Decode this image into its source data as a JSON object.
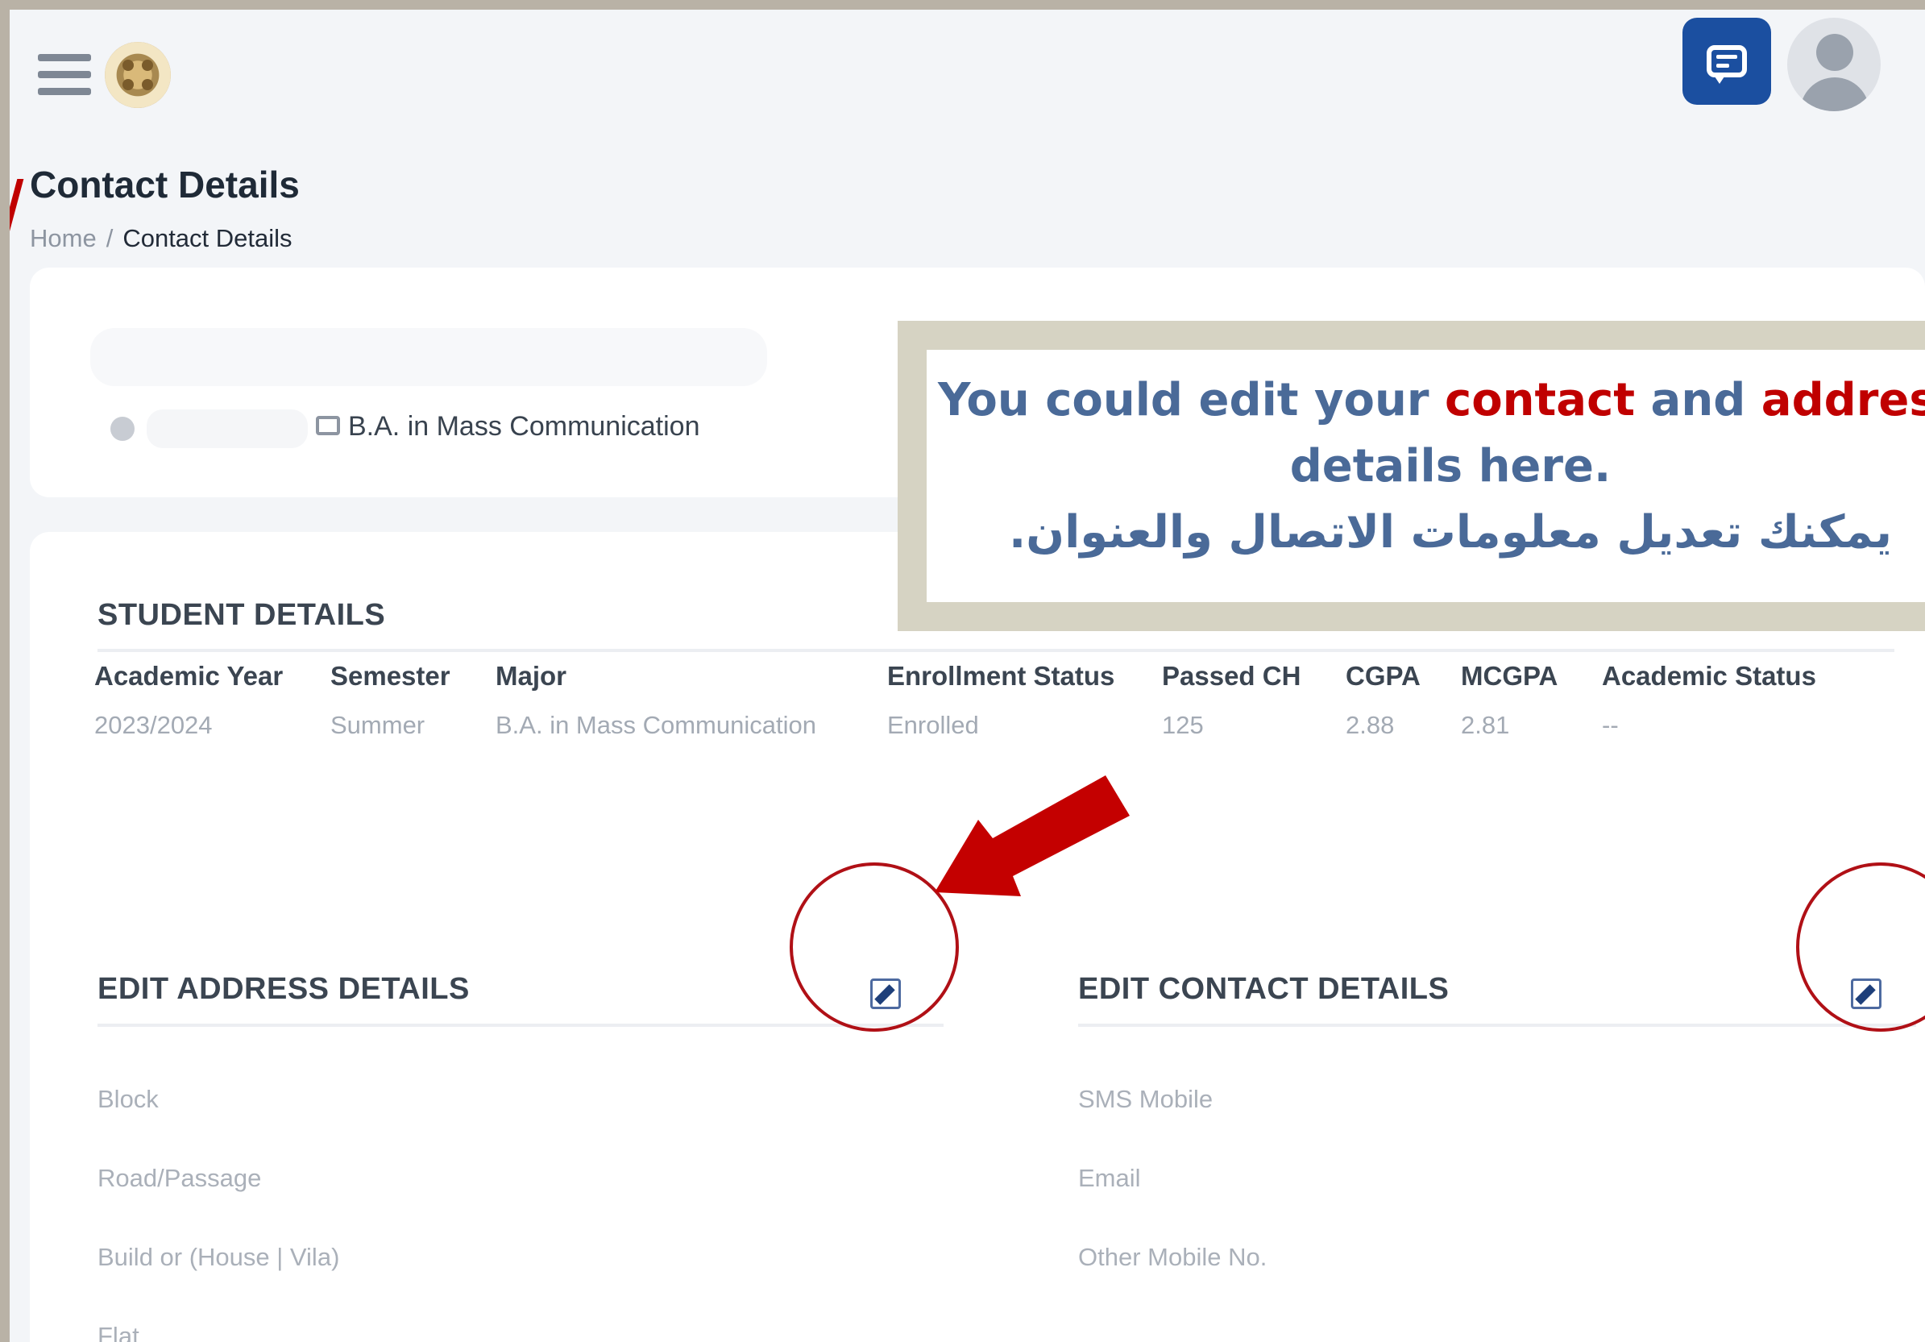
{
  "header": {
    "menu_icon": "hamburger-icon",
    "logo_icon": "university-logo",
    "chat_icon": "chat-icon",
    "avatar_icon": "user-avatar-icon"
  },
  "page": {
    "title": "Contact Details",
    "breadcrumb": {
      "home": "Home",
      "separator": "/",
      "current": "Contact Details"
    }
  },
  "profile": {
    "major": "B.A. in Mass Communication"
  },
  "student_details": {
    "title": "STUDENT DETAILS",
    "headers": [
      "Academic Year",
      "Semester",
      "Major",
      "Enrollment Status",
      "Passed CH",
      "CGPA",
      "MCGPA",
      "Academic Status"
    ],
    "values": [
      "2023/2024",
      "Summer",
      "B.A. in Mass Communication",
      "Enrolled",
      "125",
      "2.88",
      "2.81",
      "--"
    ]
  },
  "address": {
    "title": "EDIT ADDRESS DETAILS",
    "fields": [
      "Block",
      "Road/Passage",
      "Build or (House | Vila)",
      "Flat"
    ]
  },
  "contact": {
    "title": "EDIT CONTACT DETAILS",
    "fields": [
      "SMS Mobile",
      "Email",
      "Other Mobile No."
    ]
  },
  "annotation": {
    "line1_start": "You could edit your ",
    "line1_red1": "contact",
    "line1_mid": " and ",
    "line1_red2": "address",
    "line2": "details here.",
    "line3_arabic": "يمكنك تعديل معلومات الاتصال والعنوان."
  },
  "colors": {
    "accent": "#1b4fa0",
    "annotation_red": "#c00000",
    "annotation_blue": "#4a6a98"
  }
}
